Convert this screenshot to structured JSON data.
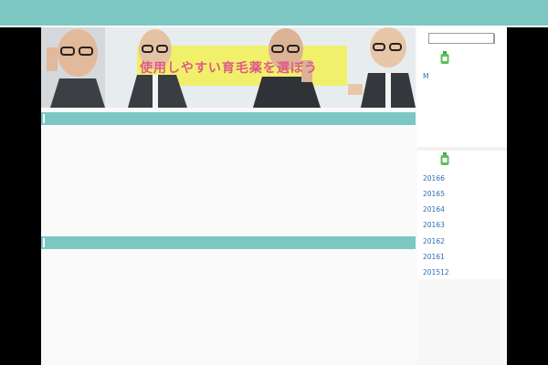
{
  "banner": {
    "title": "使用しやすい育毛薬を選ぼう"
  },
  "sidebar": {
    "widget1_link": "M",
    "archive_links": [
      "20166",
      "20165",
      "20164",
      "20163",
      "20162",
      "20161",
      "201512"
    ],
    "icon_name": "bottle-icon"
  },
  "colors": {
    "accent": "#7dc7c2",
    "background": "#000000",
    "content": "#fafafa",
    "link": "#2a6fb0",
    "banner_text": "#e05a8a",
    "banner_highlight": "#f1f06a"
  }
}
